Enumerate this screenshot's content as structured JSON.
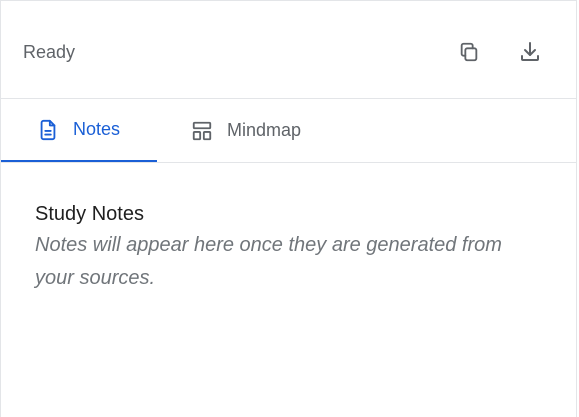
{
  "header": {
    "status": "Ready",
    "actions": [
      {
        "icon": "copy-icon"
      },
      {
        "icon": "download-icon"
      }
    ]
  },
  "tabs": [
    {
      "label": "Notes",
      "icon": "document-icon",
      "active": true
    },
    {
      "label": "Mindmap",
      "icon": "layout-icon",
      "active": false
    }
  ],
  "content": {
    "title": "Study Notes",
    "body": "Notes will appear here once they are generated from your sources."
  },
  "colors": {
    "accent": "#1a5fd6",
    "muted_text": "#5f6368",
    "placeholder_text": "#70757a",
    "border": "#e3e5e8"
  }
}
